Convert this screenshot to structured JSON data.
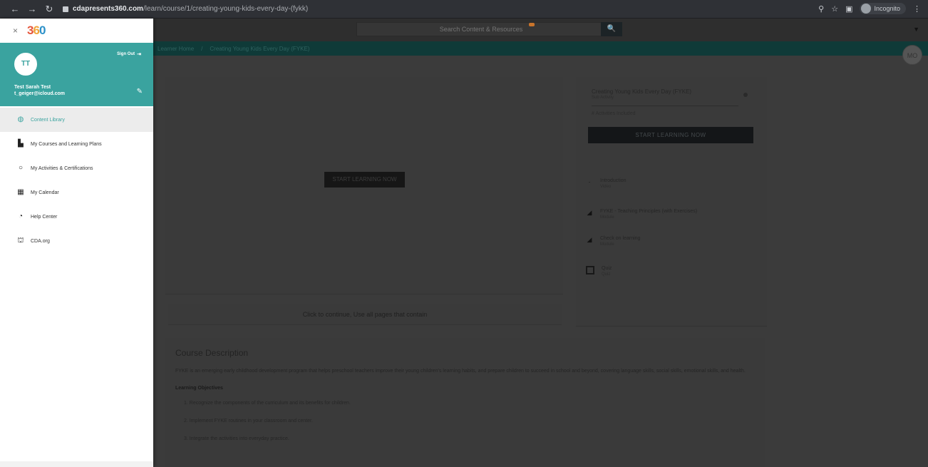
{
  "browser": {
    "back": "←",
    "forward": "→",
    "reload": "↻",
    "url_host": "cdapresents360.com",
    "url_path": "/learn/course/1/creating-young-kids-every-day-(fykk)",
    "icons": {
      "search": "search-icon",
      "star": "star-icon",
      "menu": "menu-icon"
    },
    "profile_name": "Incognito",
    "more": "⋮"
  },
  "app_bg": {
    "search_placeholder": "Search Content & Resources",
    "search_button": "🔍",
    "breadcrumb": [
      "Learner Home",
      "Creating Young Kids Every Day (FYKE)"
    ],
    "avatar_initials": "MO",
    "video_button": "START LEARNING NOW",
    "video_caption": "Click to continue, Use all pages that contain",
    "panel_title": "Creating Young Kids Every Day (FYKE)",
    "panel_sub": "Sub Activity",
    "panel_field": "# Activities Included",
    "panel_button": "START LEARNING NOW",
    "steps": [
      {
        "title": "Introduction",
        "sub": "Video"
      },
      {
        "title": "FYKE - Teaching Principles (with Exercises)",
        "sub": "Module"
      },
      {
        "title": "Check on learning",
        "sub": "Module"
      },
      {
        "title": "Quiz",
        "sub": "Quiz"
      }
    ],
    "desc_title": "Course Description",
    "desc_text": "FYKE is an emerging early childhood development program that helps preschool teachers improve their young children's learning habits, and prepare children to succeed in school and beyond, covering language skills, social skills, emotional skills, and health.",
    "desc_sub": "Learning Objectives",
    "objectives": [
      "1. Recognize the components of the curriculum and its benefits for children.",
      "2. Implement FYKE routines in your classroom and center.",
      "3. Integrate the activities into everyday practice."
    ]
  },
  "drawer": {
    "close": "×",
    "logo": {
      "a": "3",
      "b": "6",
      "c": "0"
    },
    "user": {
      "initials": "TT",
      "sign_out": "Sign Out",
      "name": "Test Sarah Test",
      "email": "t_geiger@icloud.com"
    },
    "menu": [
      {
        "label": "Content Library",
        "icon": "◍",
        "active": true
      },
      {
        "label": "My Courses and Learning Plans",
        "icon": "▙",
        "active": false
      },
      {
        "label": "My Activities & Certifications",
        "icon": "○",
        "active": false
      },
      {
        "label": "My Calendar",
        "icon": "▦",
        "active": false
      },
      {
        "label": "Help Center",
        "icon": "◔",
        "active": false
      },
      {
        "label": "CDA.org",
        "icon": "⛫",
        "active": false
      }
    ]
  }
}
